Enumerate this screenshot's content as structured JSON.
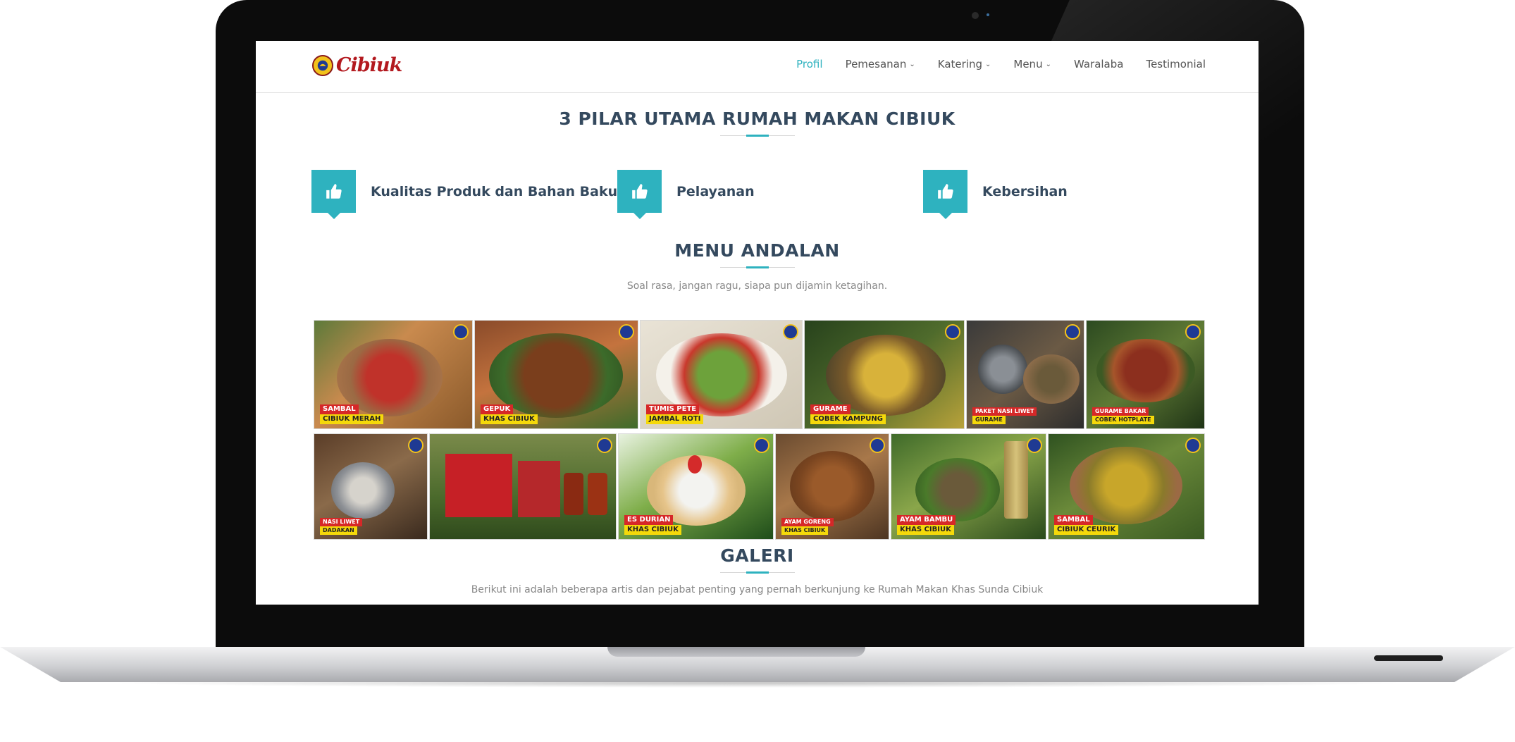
{
  "nav": {
    "logo_text": "Cibiuk",
    "links": [
      {
        "label": "Profil",
        "active": true,
        "dropdown": false
      },
      {
        "label": "Pemesanan",
        "active": false,
        "dropdown": true
      },
      {
        "label": "Katering",
        "active": false,
        "dropdown": true
      },
      {
        "label": "Menu",
        "active": false,
        "dropdown": true
      },
      {
        "label": "Waralaba",
        "active": false,
        "dropdown": false
      },
      {
        "label": "Testimonial",
        "active": false,
        "dropdown": false
      }
    ]
  },
  "pillars": {
    "title": "3 PILAR UTAMA RUMAH MAKAN CIBIUK",
    "items": [
      {
        "label": "Kualitas Produk dan Bahan Baku",
        "icon": "thumbs-up-icon"
      },
      {
        "label": "Pelayanan",
        "icon": "thumbs-up-icon"
      },
      {
        "label": "Kebersihan",
        "icon": "thumbs-up-icon"
      }
    ]
  },
  "menu_andalan": {
    "title": "MENU ANDALAN",
    "subtitle": "Soal rasa, jangan ragu, siapa pun dijamin ketagihan.",
    "row1": [
      {
        "top": "SAMBAL",
        "bottom": "CIBIUK MERAH"
      },
      {
        "top": "GEPUK",
        "bottom": "KHAS CIBIUK"
      },
      {
        "top": "TUMIS PETE",
        "bottom": "JAMBAL ROTI"
      },
      {
        "top": "GURAME",
        "bottom": "COBEK KAMPUNG"
      },
      {
        "top": "PAKET NASI LIWET",
        "bottom": "GURAME"
      },
      {
        "top": "GURAME BAKAR",
        "bottom": "COBEK HOTPLATE"
      }
    ],
    "row2": [
      {
        "top": "NASI LIWET",
        "bottom": "DADAKAN"
      },
      {
        "top": "",
        "bottom": ""
      },
      {
        "top": "ES DURIAN",
        "bottom": "KHAS CIBIUK"
      },
      {
        "top": "AYAM GORENG",
        "bottom": "KHAS CIBIUK"
      },
      {
        "top": "AYAM BAMBU",
        "bottom": "KHAS CIBIUK"
      },
      {
        "top": "SAMBAL",
        "bottom": "CIBIUK CEURIK"
      }
    ]
  },
  "galeri": {
    "title": "GALERI",
    "subtitle": "Berikut ini adalah beberapa artis dan pejabat penting yang pernah berkunjung ke Rumah Makan Khas Sunda Cibiuk"
  },
  "colors": {
    "accent": "#2eb2bf",
    "heading": "#34495e",
    "logo_red": "#b3191f"
  }
}
